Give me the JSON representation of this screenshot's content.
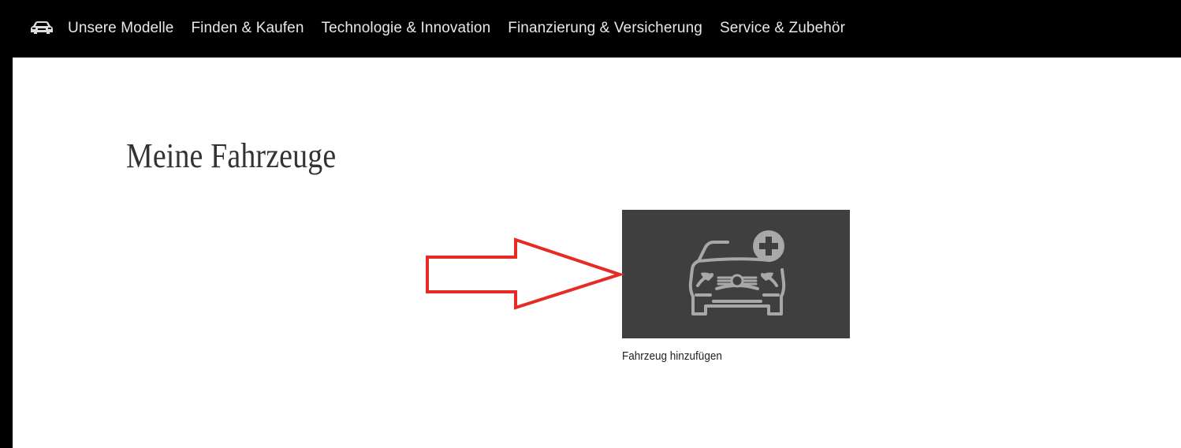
{
  "nav": {
    "items": [
      {
        "label": "Unsere Modelle"
      },
      {
        "label": "Finden & Kaufen"
      },
      {
        "label": "Technologie & Innovation"
      },
      {
        "label": "Finanzierung & Versicherung"
      },
      {
        "label": "Service & Zubehör"
      }
    ],
    "logo_icon": "car-icon"
  },
  "page": {
    "title": "Meine Fahrzeuge"
  },
  "vehicles": {
    "add_tile": {
      "icon": "car-plus-icon",
      "caption": "Fahrzeug hinzufügen"
    }
  },
  "annotation": {
    "arrow_color": "#e52b24",
    "arrow_direction": "right"
  },
  "colors": {
    "nav_background": "#000000",
    "tile_background": "#3f3f3f",
    "icon_color": "#a8a8a8"
  }
}
